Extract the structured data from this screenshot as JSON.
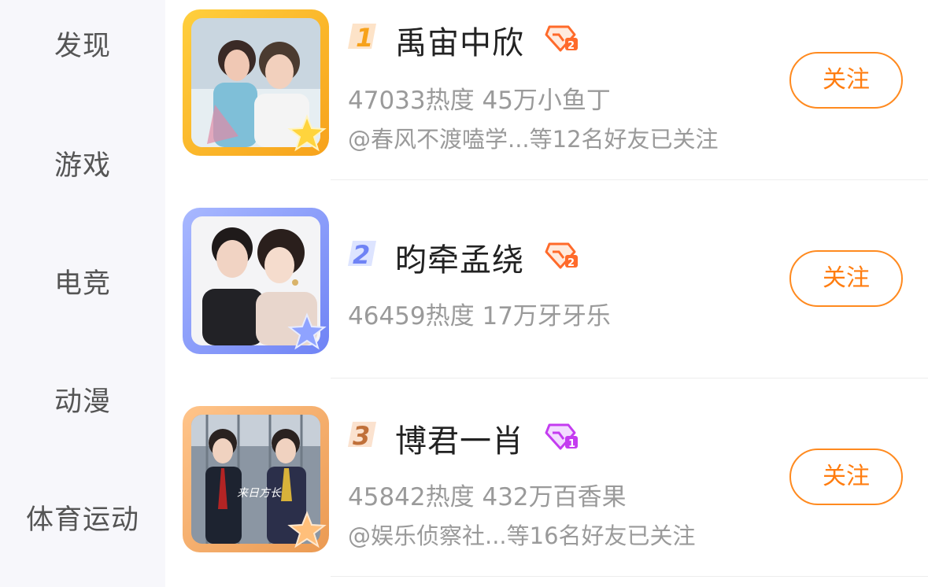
{
  "sidebar": {
    "items": [
      {
        "label": "发现"
      },
      {
        "label": "游戏"
      },
      {
        "label": "电竞"
      },
      {
        "label": "动漫"
      },
      {
        "label": "体育运动"
      }
    ]
  },
  "colors": {
    "accent": "#ff7d10",
    "rank1": "#f7a21b",
    "rank2": "#6f83f5",
    "rank3": "#eb9a52"
  },
  "list": [
    {
      "rank": "1",
      "name": "禹宙中欣",
      "badge": "diamond-orange-icon",
      "heat": "47033热度",
      "fans": "45万小鱼丁",
      "friends": "@春风不渡嗑学...等12名好友已关注",
      "follow_label": "关注"
    },
    {
      "rank": "2",
      "name": "昀牵孟绕",
      "badge": "diamond-orange-icon",
      "heat": "46459热度",
      "fans": "17万牙牙乐",
      "friends": "",
      "follow_label": "关注"
    },
    {
      "rank": "3",
      "name": "博君一肖",
      "badge": "diamond-purple-icon",
      "heat": "45842热度",
      "fans": "432万百香果",
      "friends": "@娱乐侦察社...等16名好友已关注",
      "follow_label": "关注"
    }
  ]
}
